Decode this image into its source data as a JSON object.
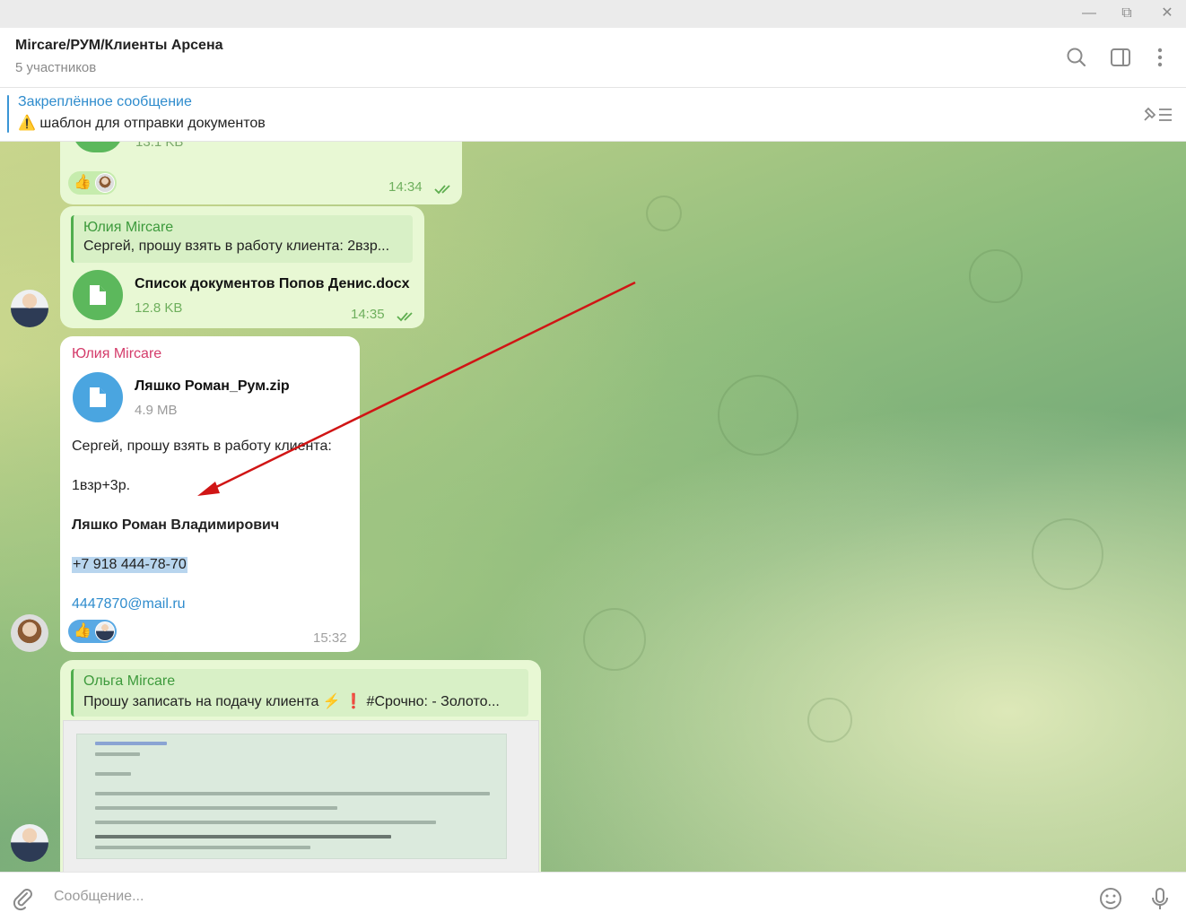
{
  "window": {
    "minimize": "—",
    "restore": "⧉",
    "close": "✕"
  },
  "header": {
    "title": "Mircare/РУМ/Клиенты Арсена",
    "subtitle": "5 участников",
    "icons": [
      "search-icon",
      "sidebar-toggle-icon",
      "more-vertical-icon"
    ]
  },
  "pinned": {
    "title": "Закреплённое сообщение",
    "emoji": "⚠️",
    "text": "шаблон для отправки документов"
  },
  "messages": [
    {
      "partial_size": "13.1 KB",
      "time": "14:34",
      "reaction": "👍"
    },
    {
      "reply_name": "Юлия Mircare",
      "reply_text": "Сергей, прошу взять в работу клиента:  2взр...",
      "file_name": "Список документов Попов Денис.docx",
      "file_size": "12.8 KB",
      "time": "14:35"
    },
    {
      "author": "Юлия Mircare",
      "file_name": "Ляшко Роман_Рум.zip",
      "file_size": "4.9 MB",
      "lines": [
        "Сергей, прошу взять в работу клиента:",
        "1взр+3р.",
        "Ляшко Роман Владимирович",
        "+7 918 444-78-70",
        "4447870@mail.ru"
      ],
      "time": "15:32",
      "reaction": "👍"
    },
    {
      "reply_name": "Ольга Mircare",
      "reply_text": "Прошу записать на подачу клиента ⚡ ❗ #Срочно:  - Золото..."
    }
  ],
  "composer": {
    "placeholder": "Сообщение..."
  },
  "colors": {
    "accent": "#3a95d5",
    "reply_green": "#4fae4e",
    "bubble_out": "#e8f8d4",
    "arrow": "#d01515"
  }
}
